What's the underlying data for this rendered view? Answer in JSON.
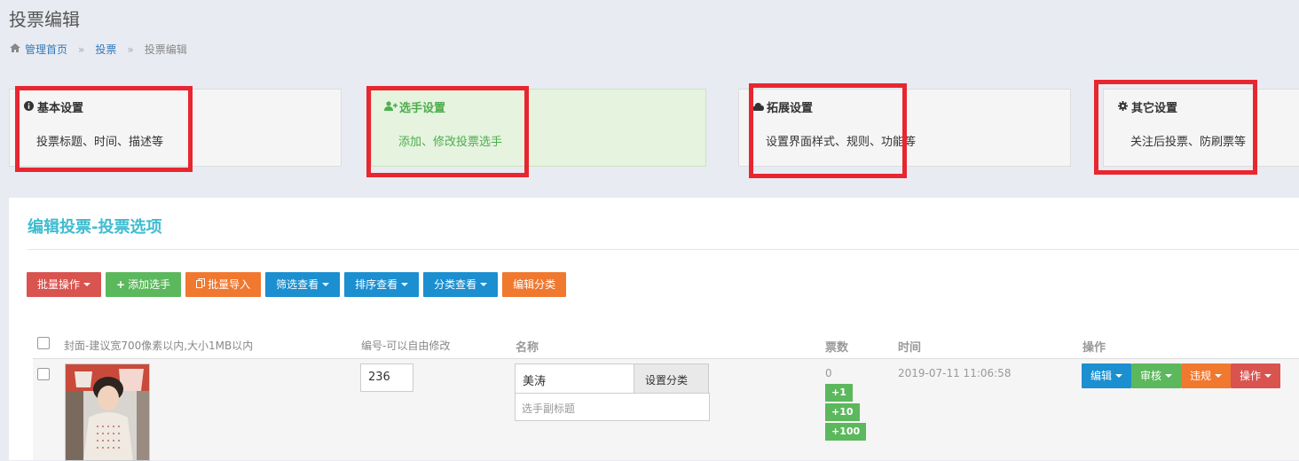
{
  "page": {
    "title": "投票编辑"
  },
  "breadcrumb": {
    "home": "管理首页",
    "section": "投票",
    "current": "投票编辑",
    "sep": "»"
  },
  "cards": [
    {
      "title": "基本设置",
      "desc": "投票标题、时间、描述等",
      "icon": "info-circle-icon"
    },
    {
      "title": "选手设置",
      "desc": "添加、修改投票选手",
      "icon": "user-plus-icon"
    },
    {
      "title": "拓展设置",
      "desc": "设置界面样式、规则、功能等",
      "icon": "cloud-icon"
    },
    {
      "title": "其它设置",
      "desc": "关注后投票、防刷票等",
      "icon": "gear-icon"
    }
  ],
  "panel": {
    "title": "编辑投票-投票选项"
  },
  "toolbar": {
    "batch_ops": "批量操作",
    "add_player": "添加选手",
    "batch_import": "批量导入",
    "filter_view": "筛选查看",
    "sort_view": "排序查看",
    "category_view": "分类查看",
    "edit_category": "编辑分类"
  },
  "table": {
    "headers": {
      "cover": "封面-建议宽700像素以内,大小1MB以内",
      "number": "编号-可以自由修改",
      "name": "名称",
      "votes": "票数",
      "time": "时间",
      "actions": "操作"
    },
    "rows": [
      {
        "number": "236",
        "name": "美涛",
        "category_button": "设置分类",
        "subtitle_placeholder": "选手副标题",
        "votes": "0",
        "vote_buttons": [
          "+1",
          "+10",
          "+100"
        ],
        "time": "2019-07-11 11:06:58",
        "actions": [
          "编辑",
          "审核",
          "违规",
          "操作"
        ]
      }
    ]
  },
  "colors": {
    "accent": "#3fbcd0",
    "highlight_box": "#e8262f",
    "btn_red": "#d9534f",
    "btn_green": "#5cb85c",
    "btn_orange": "#f0782f",
    "btn_blue": "#1b8fd0"
  }
}
